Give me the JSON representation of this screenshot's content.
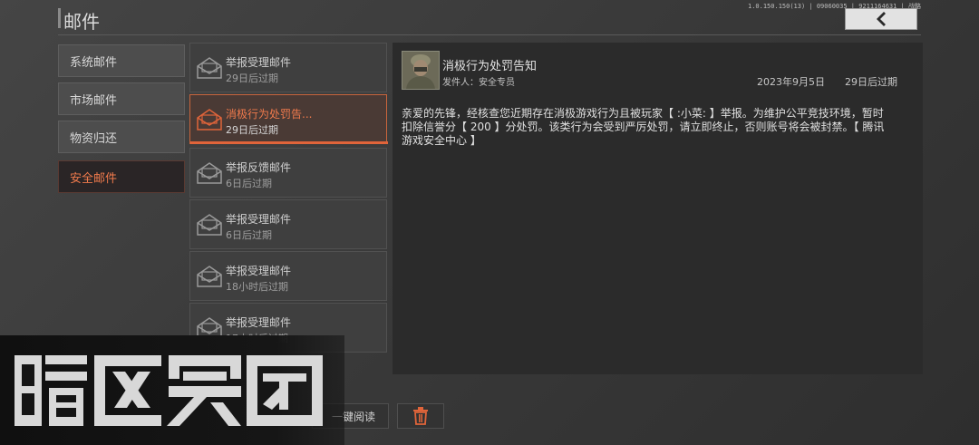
{
  "header": {
    "title": "邮件",
    "version": "1.0.150.150(13) | 09060035 | 9211164631 | 战略"
  },
  "categories": [
    {
      "label": "系统邮件",
      "active": false
    },
    {
      "label": "市场邮件",
      "active": false
    },
    {
      "label": "物资归还",
      "active": false
    },
    {
      "label": "安全邮件",
      "active": true
    }
  ],
  "mails": [
    {
      "title": "举报受理邮件",
      "sub": "29日后过期",
      "active": false
    },
    {
      "title": "消极行为处罚告...",
      "sub": "29日后过期",
      "active": true
    },
    {
      "title": "举报反馈邮件",
      "sub": "6日后过期",
      "active": false
    },
    {
      "title": "举报受理邮件",
      "sub": "6日后过期",
      "active": false
    },
    {
      "title": "举报受理邮件",
      "sub": "18小时后过期",
      "active": false
    },
    {
      "title": "举报受理邮件",
      "sub": "17小时后过期",
      "active": false
    }
  ],
  "detail": {
    "title": "消极行为处罚告知",
    "sender": "发件人：安全专员",
    "date": "2023年9月5日",
    "expire": "29日后过期",
    "body": "亲爱的先锋，经核查您近期存在消极游戏行为且被玩家【 :小菜: 】举报。为维护公平竞技环境，暂时扣除信誉分【 200 】分处罚。该类行为会受到严厉处罚，请立即终止，否则账号将会被封禁。【 腾讯游戏安全中心 】"
  },
  "footer": {
    "read_all": "一键阅读"
  },
  "watermark": {
    "logo_text": "暗区突围"
  },
  "colors": {
    "accent": "#f07a4c",
    "active_underline": "#e0643a",
    "trash": "#e0643a"
  },
  "icons": {
    "back": "chevron-left-icon",
    "mail": "envelope-icon",
    "trash": "trash-icon"
  }
}
